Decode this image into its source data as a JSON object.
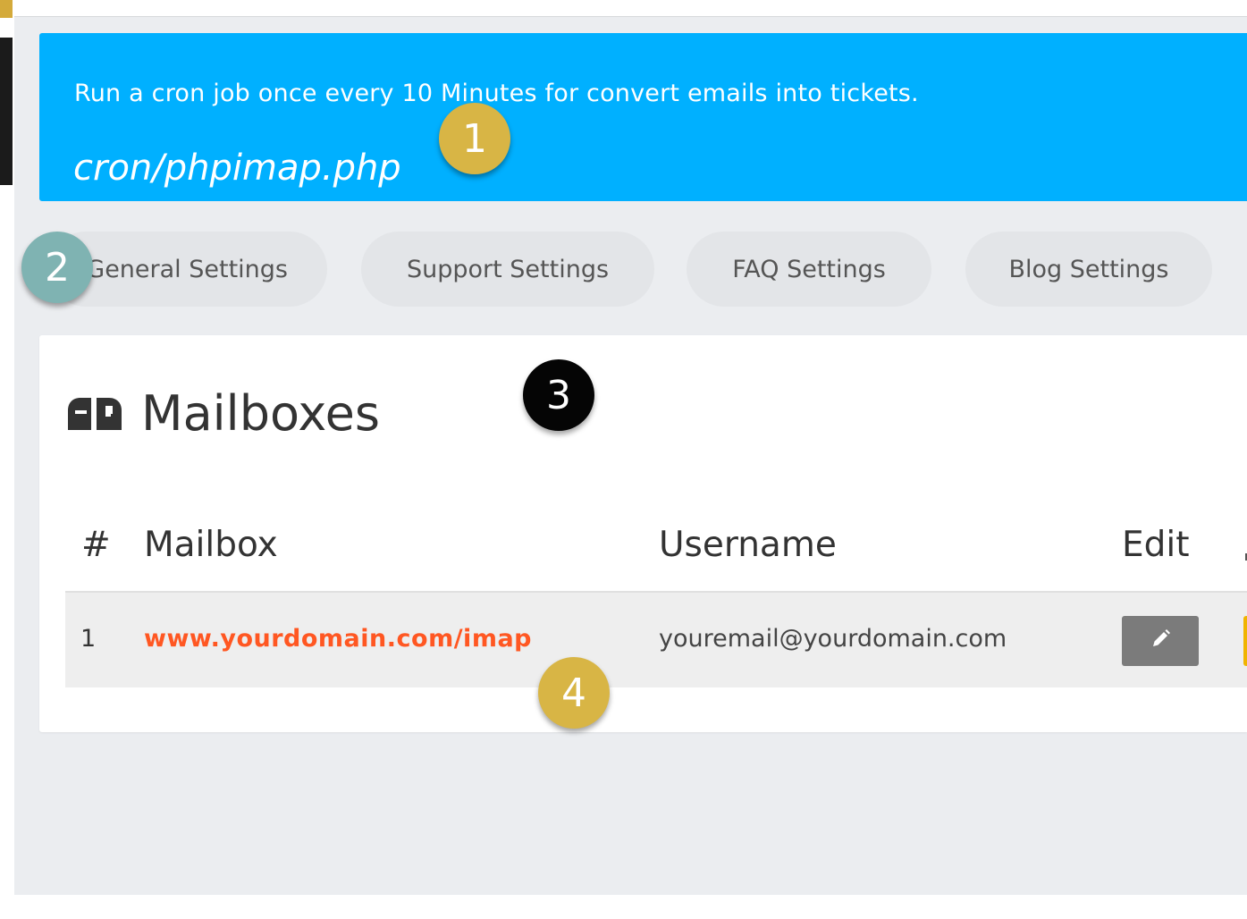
{
  "alert": {
    "message": "Run a cron job once every 10 Minutes for convert emails into tickets.",
    "command": "cron/phpimap.php"
  },
  "tabs": [
    {
      "label": "General Settings"
    },
    {
      "label": "Support Settings"
    },
    {
      "label": "FAQ Settings"
    },
    {
      "label": "Blog Settings"
    }
  ],
  "card": {
    "icon": "mailbox-icon",
    "title": "Mailboxes"
  },
  "table": {
    "headers": {
      "num": "#",
      "mailbox": "Mailbox",
      "username": "Username",
      "edit": "Edit"
    },
    "rows": [
      {
        "num": "1",
        "mailbox": "www.yourdomain.com/imap",
        "username": "youremail@yourdomain.com",
        "edit_icon": "pencil-icon"
      }
    ]
  },
  "markers": [
    "1",
    "2",
    "3",
    "4"
  ],
  "colors": {
    "alert_bg": "#00b0ff",
    "content_bg": "#ebedf0",
    "tab_bg": "#e3e5e8",
    "link": "#ff5722",
    "edit_button": "#7b7b7b",
    "marker_gold": "#d8b545",
    "marker_teal": "#7fb3b2",
    "marker_black": "#050505"
  }
}
